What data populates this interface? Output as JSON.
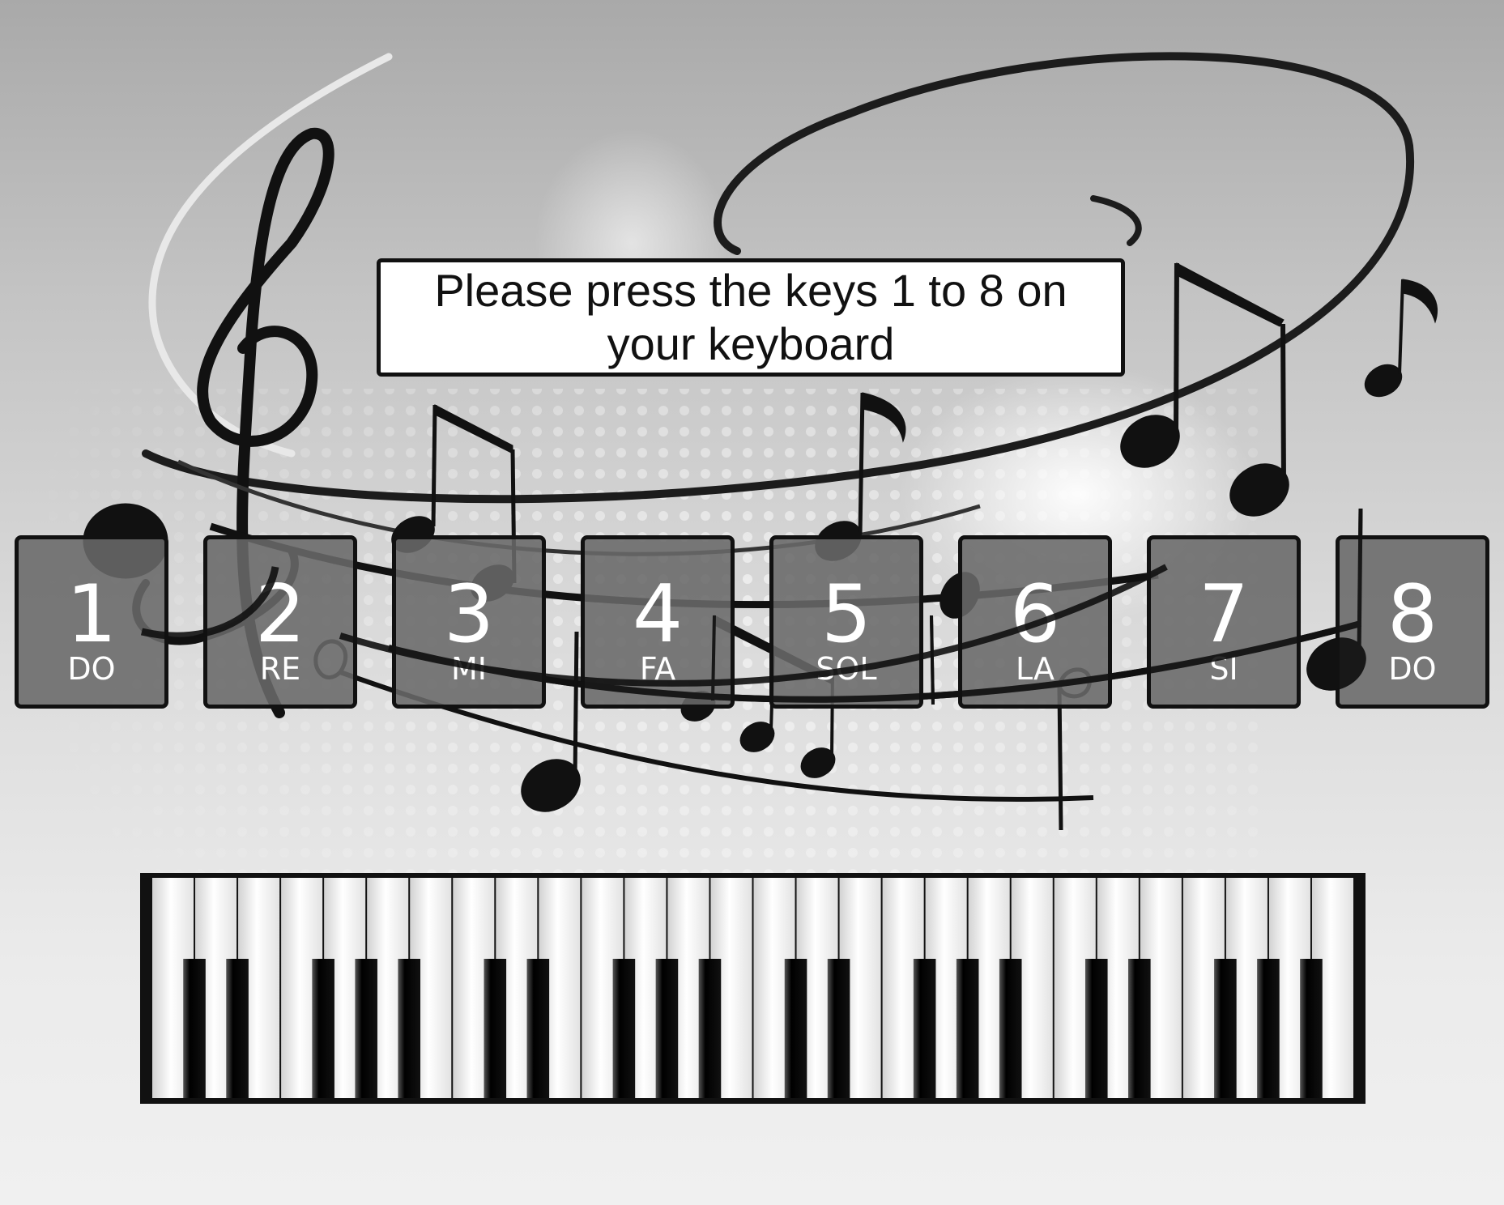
{
  "instruction": "Please press the keys 1 to 8 on your keyboard",
  "keys": [
    {
      "number": "1",
      "note": "DO"
    },
    {
      "number": "2",
      "note": "RE"
    },
    {
      "number": "3",
      "note": "MI"
    },
    {
      "number": "4",
      "note": "FA"
    },
    {
      "number": "5",
      "note": "SOL"
    },
    {
      "number": "6",
      "note": "LA"
    },
    {
      "number": "7",
      "note": "SI"
    },
    {
      "number": "8",
      "note": "DO"
    }
  ],
  "piano": {
    "white_keys": 28
  },
  "colors": {
    "key_fill": "#696969",
    "border": "#111111",
    "text": "#ffffff"
  }
}
